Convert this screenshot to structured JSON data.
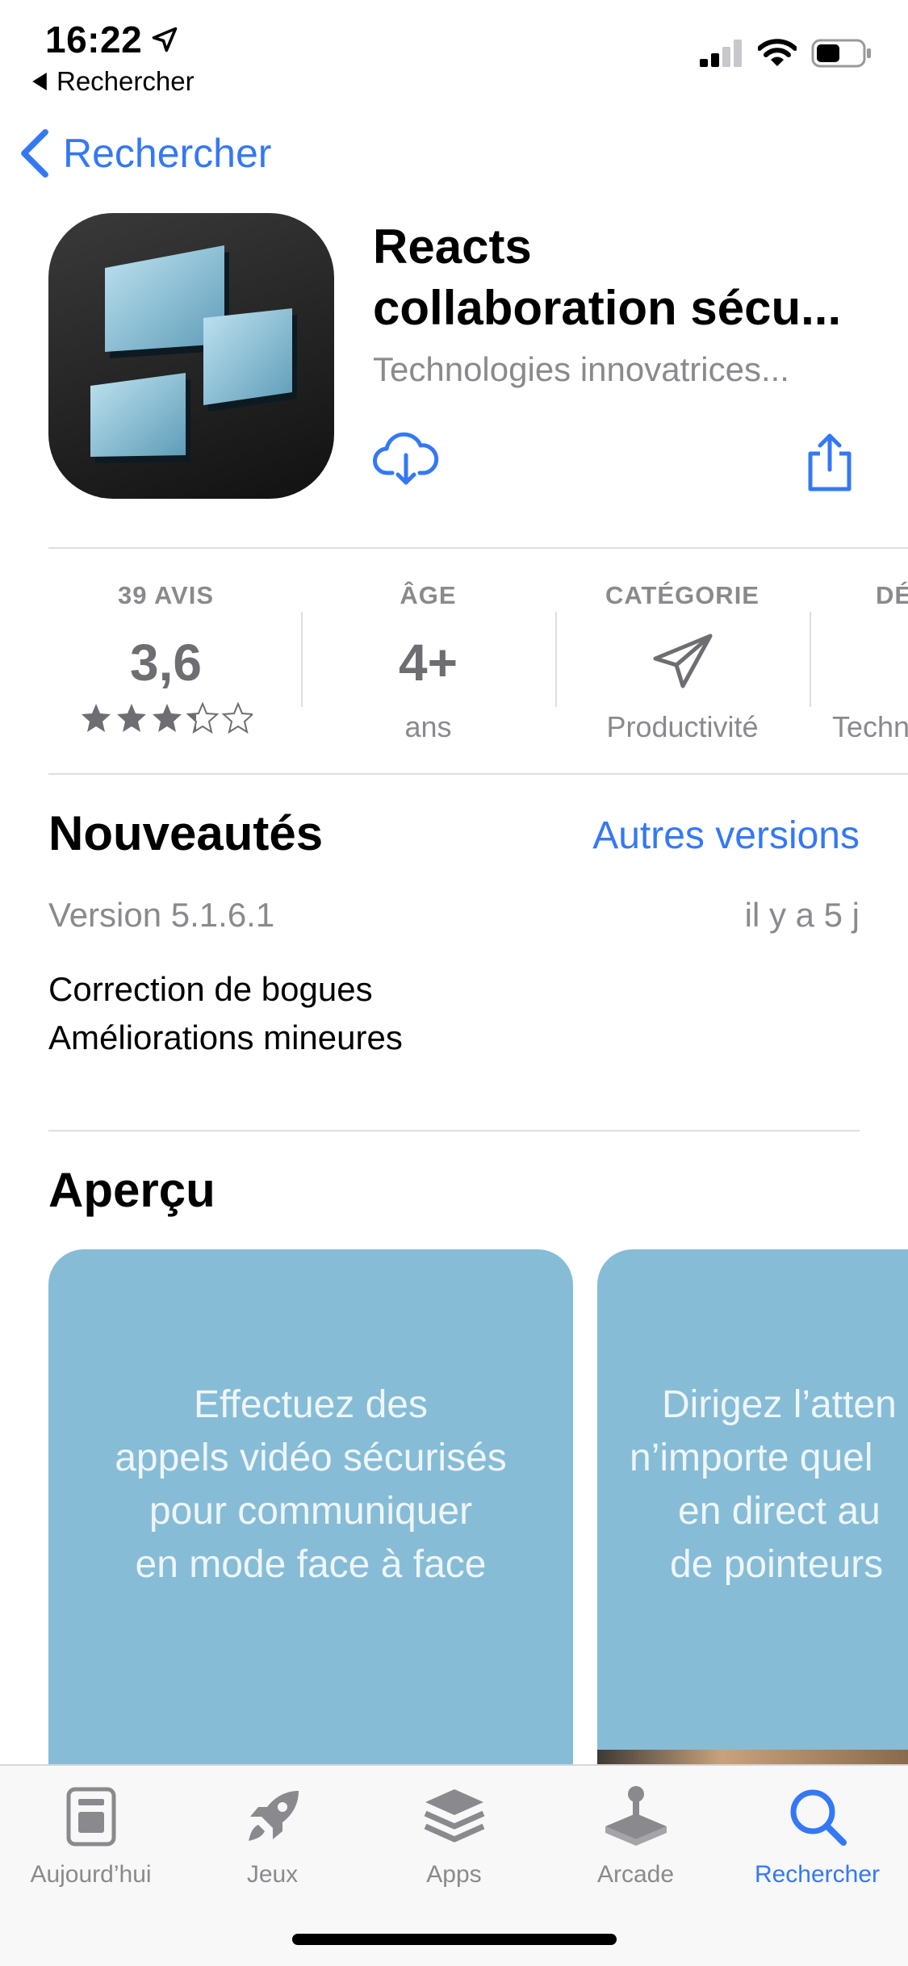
{
  "status_bar": {
    "time": "16:22",
    "back_label": "Rechercher"
  },
  "nav": {
    "back_label": "Rechercher"
  },
  "app": {
    "title_line1": "Reacts",
    "title_line2": "collaboration sécu...",
    "subtitle": "Technologies innovatrices..."
  },
  "info": {
    "ratings_label": "39 AVIS",
    "rating_value": "3,6",
    "rating_stars": 3.6,
    "age_label": "ÂGE",
    "age_value": "4+",
    "age_sub": "ans",
    "category_label": "CATÉGORIE",
    "category_sub": "Productivité",
    "developer_label": "DÉ",
    "developer_sub": "Techn"
  },
  "whats_new": {
    "title": "Nouveautés",
    "versions_link": "Autres versions",
    "version": "Version 5.1.6.1",
    "date": "il y a 5 j",
    "note_line1": "Correction de bogues",
    "note_line2": "Améliorations mineures"
  },
  "preview": {
    "title": "Aperçu",
    "card1_lines": [
      "Effectuez des",
      "appels vidéo sécurisés",
      "pour communiquer",
      "en mode face à face"
    ],
    "card2_lines": [
      "Dirigez l’atten",
      "n’importe quel",
      "en direct au",
      "de pointeurs"
    ]
  },
  "tabs": [
    {
      "label": "Aujourd’hui",
      "icon": "today-icon"
    },
    {
      "label": "Jeux",
      "icon": "rocket-icon"
    },
    {
      "label": "Apps",
      "icon": "apps-stack-icon"
    },
    {
      "label": "Arcade",
      "icon": "joystick-icon"
    },
    {
      "label": "Rechercher",
      "icon": "search-icon"
    }
  ],
  "colors": {
    "accent": "#3478f6",
    "secondary_text": "#8a8a8e",
    "preview_card": "#87bcd6"
  }
}
